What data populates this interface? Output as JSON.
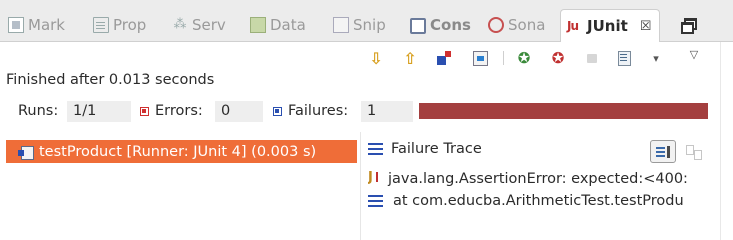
{
  "tabs": [
    {
      "label": "Mark",
      "icon": "markers-icon"
    },
    {
      "label": "Prop",
      "icon": "properties-icon"
    },
    {
      "label": "Serv",
      "icon": "servers-icon"
    },
    {
      "label": "Data",
      "icon": "data-source-icon"
    },
    {
      "label": "Snip",
      "icon": "snippets-icon"
    },
    {
      "label": "Cons",
      "icon": "console-icon"
    },
    {
      "label": "Sona",
      "icon": "sonar-icon"
    },
    {
      "label": "JUnit",
      "icon": "junit-icon",
      "active": true,
      "close": "☒"
    }
  ],
  "toolbar": {
    "icons": [
      "next-failure-icon",
      "previous-failure-icon",
      "show-failures-only-icon",
      "test-history-icon",
      "rerun-test-icon",
      "rerun-failed-first-icon",
      "stop-icon",
      "layout-icon",
      "dropdown-icon",
      "view-menu-icon"
    ],
    "next_glyph": "⇩",
    "prev_glyph": "⇧",
    "rerun_glyph": "✪",
    "dropdown_glyph": "▾",
    "view_menu_glyph": "▽"
  },
  "status": "Finished after 0.013 seconds",
  "counters": {
    "runs_label": "Runs:",
    "runs_value": "1/1",
    "errors_label": "Errors:",
    "errors_value": "0",
    "failures_label": "Failures:",
    "failures_value": "1",
    "progress_fraction": 1.0,
    "progress_color": "#a43f3f"
  },
  "tree": {
    "selected_item": "testProduct [Runner: JUnit 4] (0.003 s)",
    "selection_color": "#ef6d38"
  },
  "failure_trace": {
    "header": "Failure Trace",
    "lines": [
      "java.lang.AssertionError: expected:<400:",
      "at com.educba.ArithmeticTest.testProdu"
    ]
  }
}
